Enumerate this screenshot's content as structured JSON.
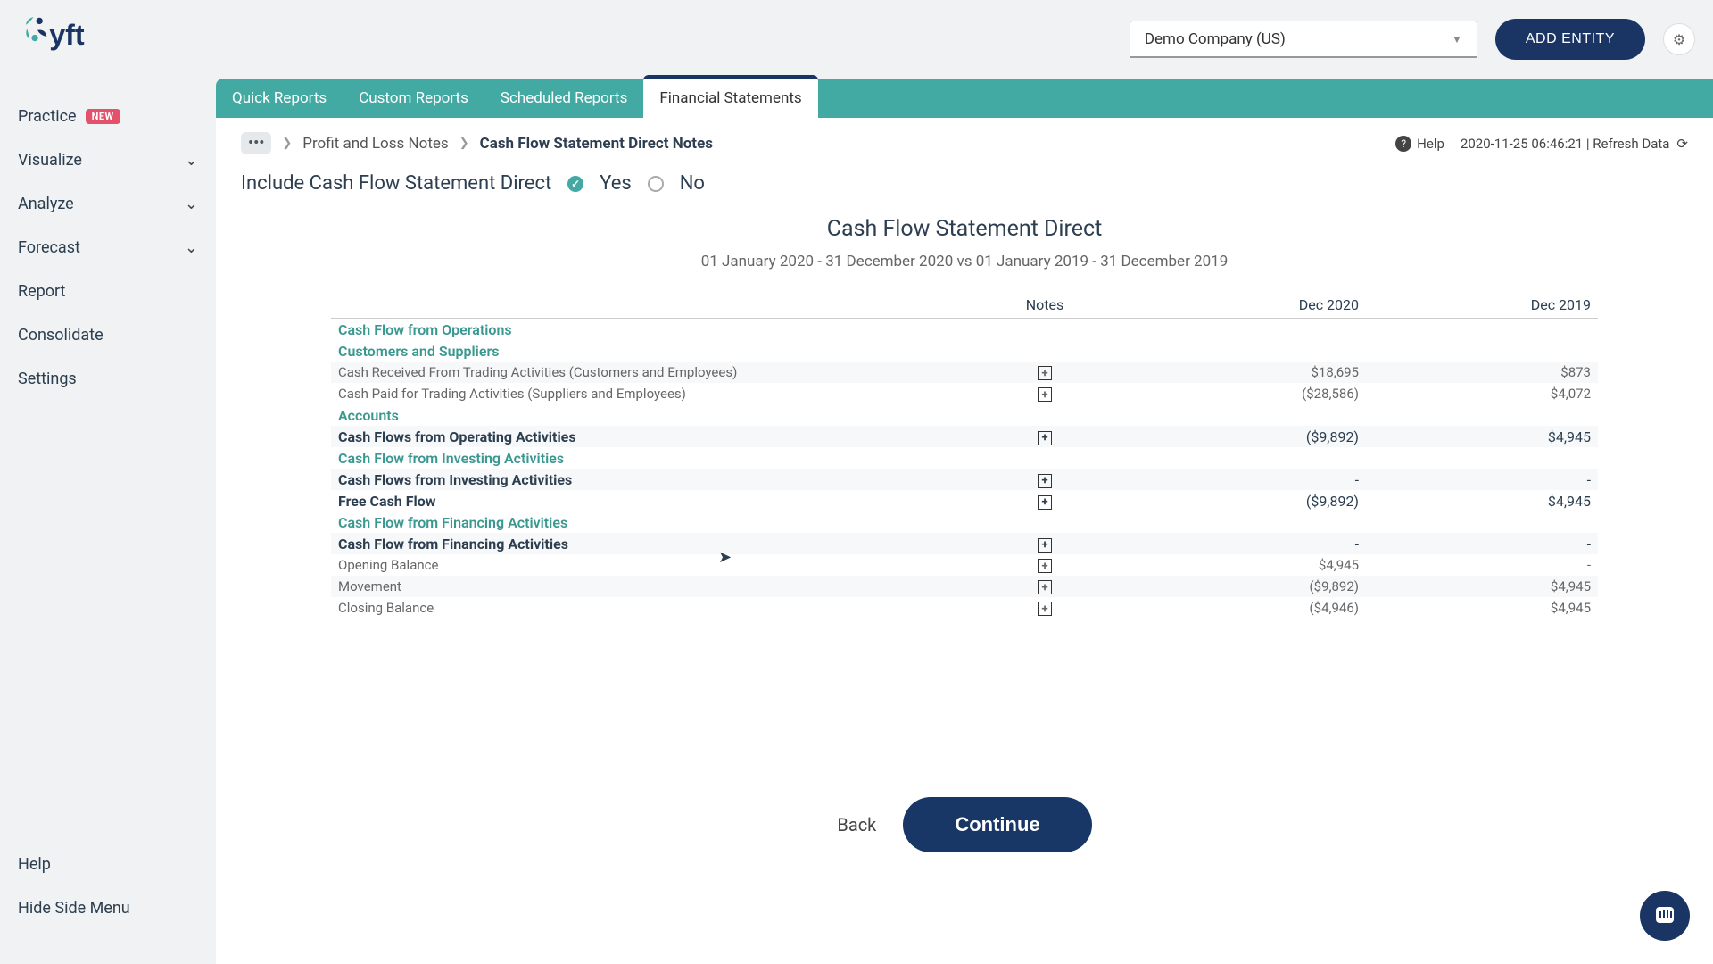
{
  "header": {
    "company": "Demo Company (US)",
    "add_entity": "ADD ENTITY"
  },
  "sidebar": {
    "items": [
      {
        "label": "Practice",
        "badge": "NEW",
        "expandable": false
      },
      {
        "label": "Visualize",
        "expandable": true
      },
      {
        "label": "Analyze",
        "expandable": true
      },
      {
        "label": "Forecast",
        "expandable": true
      },
      {
        "label": "Report",
        "expandable": false
      },
      {
        "label": "Consolidate",
        "expandable": false
      },
      {
        "label": "Settings",
        "expandable": false
      }
    ],
    "help": "Help",
    "hide": "Hide Side Menu"
  },
  "tabs": [
    {
      "label": "Quick Reports",
      "active": false
    },
    {
      "label": "Custom Reports",
      "active": false
    },
    {
      "label": "Scheduled Reports",
      "active": false
    },
    {
      "label": "Financial Statements",
      "active": true
    }
  ],
  "breadcrumb": {
    "prev": "Profit and Loss Notes",
    "current": "Cash Flow Statement Direct Notes"
  },
  "toolbar_right": {
    "help": "Help",
    "timestamp": "2020-11-25 06:46:21 | Refresh Data"
  },
  "include": {
    "label": "Include Cash Flow Statement Direct",
    "yes": "Yes",
    "no": "No",
    "selected": "yes"
  },
  "report": {
    "title": "Cash Flow Statement Direct",
    "period": "01 January 2020 - 31 December 2020 vs 01 January 2019 - 31 December 2019",
    "columns": {
      "notes": "Notes",
      "c1": "Dec 2020",
      "c2": "Dec 2019"
    }
  },
  "rows": [
    {
      "type": "section",
      "label": "Cash Flow from Operations"
    },
    {
      "type": "section",
      "label": "Customers and Suppliers"
    },
    {
      "type": "line",
      "label": "Cash Received From Trading Activities (Customers and Employees)",
      "note": true,
      "v1": "$18,695",
      "v2": "$873",
      "alt": true
    },
    {
      "type": "line",
      "label": "Cash Paid for Trading Activities (Suppliers and Employees)",
      "note": true,
      "v1": "($28,586)",
      "v2": "$4,072"
    },
    {
      "type": "section",
      "label": "Accounts"
    },
    {
      "type": "total",
      "label": "Cash Flows from Operating Activities",
      "note": true,
      "v1": "($9,892)",
      "v2": "$4,945",
      "alt": true
    },
    {
      "type": "section",
      "label": "Cash Flow from Investing Activities"
    },
    {
      "type": "total",
      "label": "Cash Flows from Investing Activities",
      "note": true,
      "v1": "-",
      "v2": "-",
      "alt": true
    },
    {
      "type": "total",
      "label": "Free Cash Flow",
      "note": true,
      "v1": "($9,892)",
      "v2": "$4,945"
    },
    {
      "type": "section",
      "label": "Cash Flow from Financing Activities"
    },
    {
      "type": "total",
      "label": "Cash Flow from Financing Activities",
      "note": true,
      "v1": "-",
      "v2": "-",
      "alt": true
    },
    {
      "type": "line",
      "label": "Opening Balance",
      "note": true,
      "v1": "$4,945",
      "v2": "-"
    },
    {
      "type": "line",
      "label": "Movement",
      "note": true,
      "v1": "($9,892)",
      "v2": "$4,945",
      "alt": true
    },
    {
      "type": "line",
      "label": "Closing Balance",
      "note": true,
      "v1": "($4,946)",
      "v2": "$4,945"
    }
  ],
  "footer": {
    "back": "Back",
    "continue": "Continue"
  }
}
